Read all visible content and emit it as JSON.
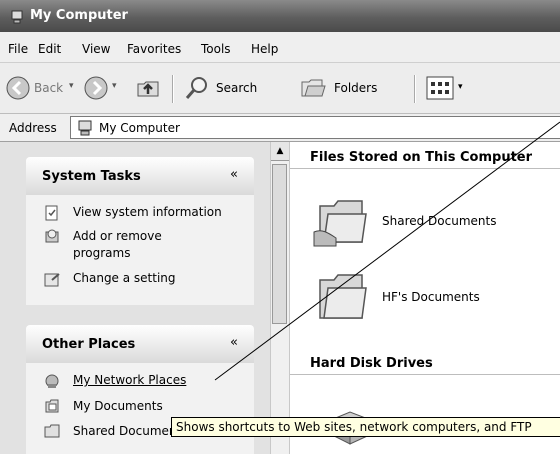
{
  "window": {
    "title": "My Computer"
  },
  "menu": [
    "File",
    "Edit",
    "View",
    "Favorites",
    "Tools",
    "Help"
  ],
  "toolbar": {
    "back": "Back",
    "search": "Search",
    "folders": "Folders"
  },
  "address": {
    "label": "Address",
    "value": "My Computer"
  },
  "system_tasks": {
    "title": "System Tasks",
    "items": [
      {
        "label": "View system information",
        "icon": "info-icon"
      },
      {
        "label": "Add or remove\nprograms",
        "icon": "cd-box-icon"
      },
      {
        "label": "Change a setting",
        "icon": "control-panel-icon"
      }
    ]
  },
  "other_places": {
    "title": "Other Places",
    "items": [
      {
        "label": "My Network Places",
        "icon": "network-icon"
      },
      {
        "label": "My Documents",
        "icon": "documents-icon"
      },
      {
        "label": "Shared Documents",
        "icon": "folder-icon"
      }
    ]
  },
  "files_section": {
    "title": "Files Stored on This Computer",
    "items": [
      "Shared Documents",
      "HF's Documents"
    ]
  },
  "drives_section": {
    "title": "Hard Disk Drives"
  },
  "tooltip": "Shows shortcuts to Web sites, network computers, and FTP"
}
